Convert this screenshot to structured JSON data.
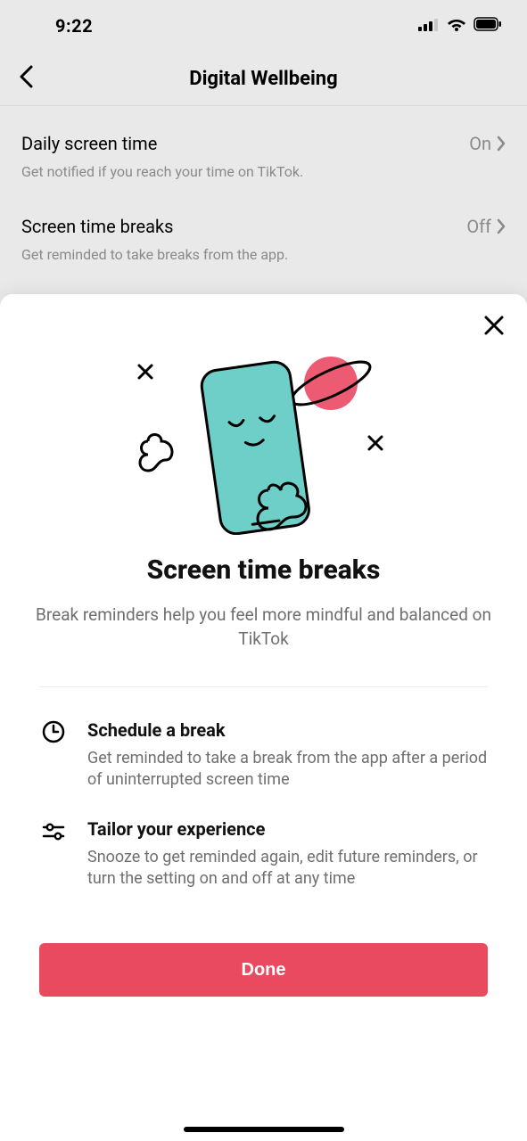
{
  "status": {
    "time": "9:22"
  },
  "header": {
    "title": "Digital Wellbeing"
  },
  "settings": [
    {
      "title": "Daily screen time",
      "value": "On",
      "desc": "Get notified if you reach your time on TikTok."
    },
    {
      "title": "Screen time breaks",
      "value": "Off",
      "desc": "Get reminded to take breaks from the app."
    }
  ],
  "sheet": {
    "title": "Screen time breaks",
    "subtitle": "Break reminders help you feel more mindful and balanced on TikTok",
    "features": [
      {
        "title": "Schedule a break",
        "desc": "Get reminded to take a break from the app after a period of uninterrupted screen time"
      },
      {
        "title": "Tailor your experience",
        "desc": "Snooze to get reminded again, edit future reminders, or turn the setting on and off at any time"
      }
    ],
    "done": "Done"
  }
}
